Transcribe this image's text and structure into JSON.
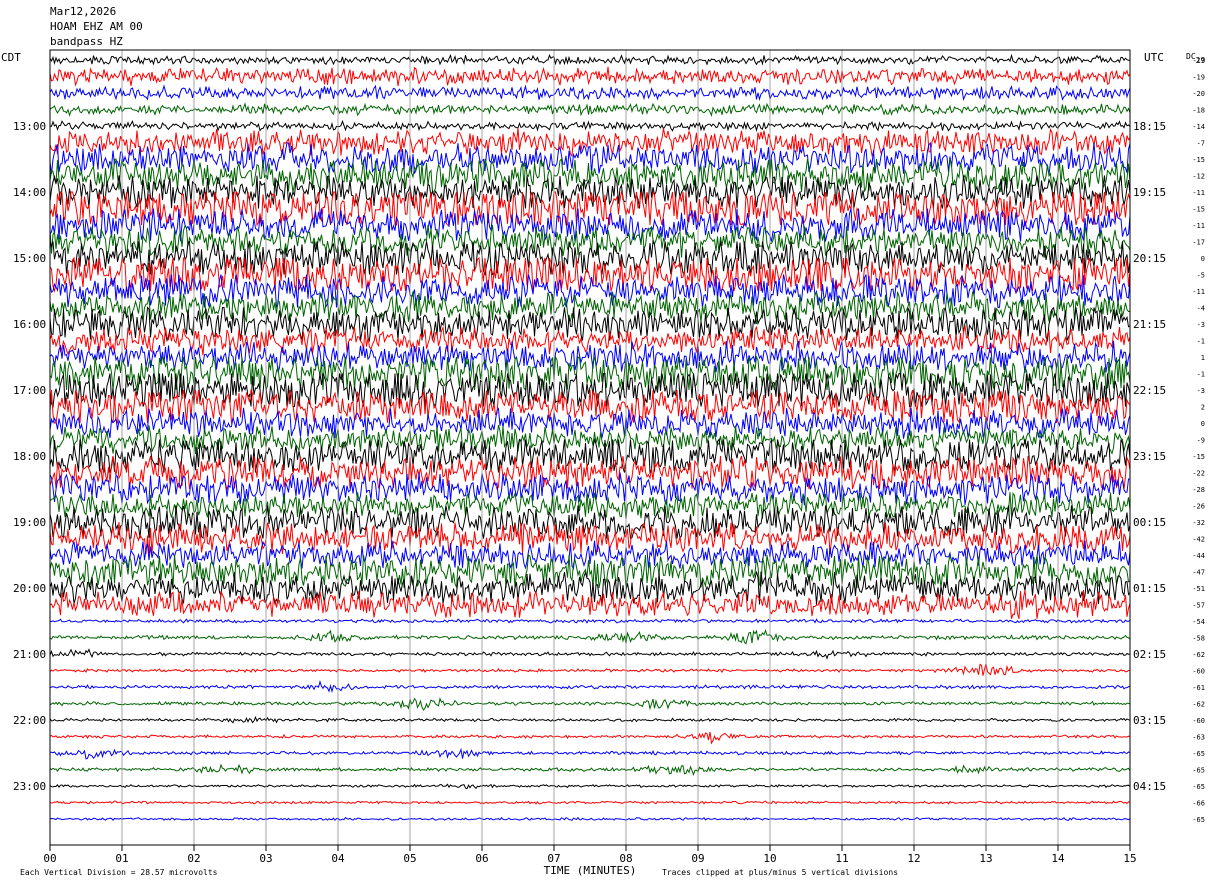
{
  "header": {
    "date": "Mar12,2026",
    "channel": "HOAM EHZ AM 00",
    "filter": "bandpass HZ"
  },
  "chart_data": {
    "type": "line",
    "left_axis_label": "CDT",
    "right_axis_label": "UTC",
    "dc_label": "DC",
    "dc_top": "29",
    "left_ticks": [
      "13:00",
      "14:00",
      "15:00",
      "16:00",
      "17:00",
      "18:00",
      "19:00",
      "20:00",
      "21:00",
      "22:00",
      "23:00"
    ],
    "right_ticks": [
      "18:15",
      "19:15",
      "20:15",
      "21:15",
      "22:15",
      "23:15",
      "00:15",
      "01:15",
      "02:15",
      "03:15",
      "04:15"
    ],
    "x_ticks": [
      "00",
      "01",
      "02",
      "03",
      "04",
      "05",
      "06",
      "07",
      "08",
      "09",
      "10",
      "11",
      "12",
      "13",
      "14",
      "15"
    ],
    "xlabel": "TIME (MINUTES)",
    "xlim": [
      0,
      15
    ],
    "trace_colors": [
      "#000000",
      "#ff0000",
      "#0000ff",
      "#006400"
    ],
    "dc_offsets": [
      -17,
      -19,
      -20,
      -18,
      -14,
      -7,
      -15,
      -12,
      -11,
      -15,
      -11,
      -17,
      0,
      -5,
      -11,
      -4,
      -3,
      -1,
      1,
      -1,
      -3,
      2,
      0,
      -9,
      -15,
      -22,
      -28,
      -26,
      -32,
      -42,
      -44,
      -47,
      -51,
      -57,
      -54,
      -58,
      -62,
      -60,
      -61,
      -62,
      -60,
      -63,
      -65,
      -65,
      -65,
      -66,
      -65
    ],
    "trace_amplitude_divisions": [
      1.0,
      2.0,
      1.5,
      1.2,
      1.0,
      3.0,
      3.5,
      4.0,
      4.0,
      5.0,
      4.0,
      3.5,
      4.5,
      5.0,
      4.0,
      3.5,
      4.0,
      3.0,
      3.5,
      4.5,
      5.0,
      4.0,
      3.5,
      3.0,
      4.5,
      4.0,
      3.5,
      3.0,
      4.0,
      3.5,
      3.0,
      4.0,
      3.5,
      3.0,
      0.4,
      0.45,
      0.4,
      0.35,
      0.4,
      0.4,
      0.35,
      0.35,
      0.4,
      0.4,
      0.3,
      0.3,
      0.3
    ],
    "events": [
      {
        "trace": 35,
        "minute": 3.9,
        "size": 2.5
      },
      {
        "trace": 35,
        "minute": 8.1,
        "size": 3.0
      },
      {
        "trace": 35,
        "minute": 9.8,
        "size": 4.0
      },
      {
        "trace": 36,
        "minute": 0.4,
        "size": 2.0
      },
      {
        "trace": 36,
        "minute": 10.9,
        "size": 1.5
      },
      {
        "trace": 37,
        "minute": 13.0,
        "size": 4.0
      },
      {
        "trace": 38,
        "minute": 3.8,
        "size": 2.0
      },
      {
        "trace": 39,
        "minute": 5.2,
        "size": 3.0
      },
      {
        "trace": 39,
        "minute": 8.5,
        "size": 2.5
      },
      {
        "trace": 40,
        "minute": 2.8,
        "size": 1.5
      },
      {
        "trace": 41,
        "minute": 9.2,
        "size": 3.0
      },
      {
        "trace": 42,
        "minute": 0.6,
        "size": 2.5
      },
      {
        "trace": 42,
        "minute": 5.6,
        "size": 3.0
      },
      {
        "trace": 43,
        "minute": 2.5,
        "size": 2.5
      },
      {
        "trace": 43,
        "minute": 8.7,
        "size": 4.0
      },
      {
        "trace": 43,
        "minute": 12.8,
        "size": 1.5
      },
      {
        "trace": 44,
        "minute": 5.7,
        "size": 1.5
      }
    ],
    "clipped_traces": [
      6,
      7,
      8,
      9,
      12,
      13,
      14,
      19,
      20,
      24,
      25,
      28
    ],
    "footer_left": "Each Vertical Division =   28.57 microvolts",
    "footer_right": "Traces clipped at plus/minus 5 vertical divisions"
  }
}
